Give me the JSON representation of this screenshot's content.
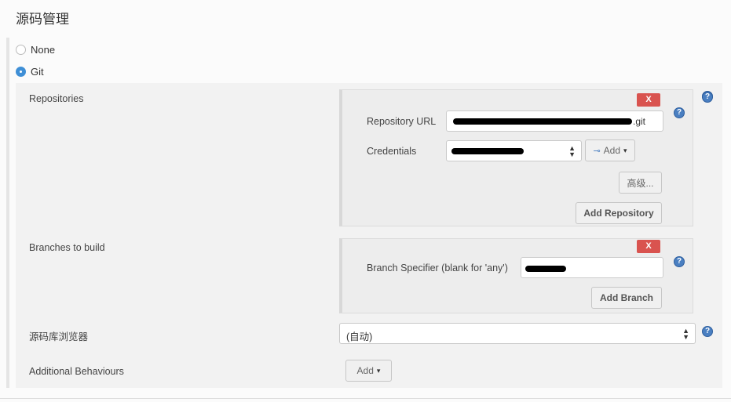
{
  "section": {
    "title": "源码管理"
  },
  "scm": {
    "options": [
      {
        "label": "None",
        "selected": false
      },
      {
        "label": "Git",
        "selected": true
      }
    ]
  },
  "git": {
    "repositories_label": "Repositories",
    "delete_label": "X",
    "repository_url_label": "Repository URL",
    "repository_url_suffix": ".git",
    "credentials_label": "Credentials",
    "add_credentials_label": "Add",
    "advanced_label": "高级...",
    "add_repository_label": "Add Repository",
    "branches_label": "Branches to build",
    "branch_specifier_label": "Branch Specifier (blank for 'any')",
    "add_branch_label": "Add Branch",
    "repo_browser_label": "源码库浏览器",
    "repo_browser_value": "(自动)",
    "additional_behaviours_label": "Additional Behaviours",
    "add_behaviour_label": "Add",
    "help_glyph": "?"
  },
  "colors": {
    "delete": "#d9534f",
    "radio_selected": "#3f8fd6",
    "help": "#4a7fc1"
  }
}
